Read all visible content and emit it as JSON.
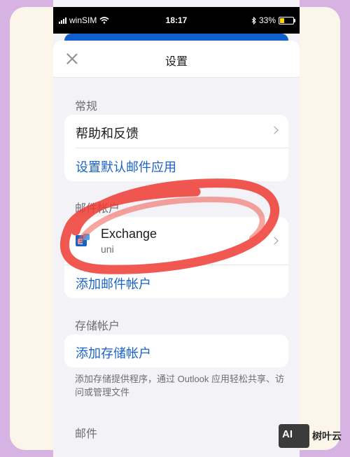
{
  "status_bar": {
    "carrier": "winSIM",
    "time": "18:17",
    "battery_percent": "33%",
    "battery_level": 0.33,
    "icons": [
      "signal-icon",
      "wifi-icon",
      "bluetooth-icon",
      "battery-icon"
    ]
  },
  "nav": {
    "title": "设置",
    "close_icon": "close-icon"
  },
  "sections": {
    "general": {
      "header": "常规",
      "help_label": "帮助和反馈",
      "default_mail_label": "设置默认邮件应用"
    },
    "mail_accounts": {
      "header": "邮件帐户",
      "account_name": "Exchange",
      "account_sub": "uni",
      "add_label": "添加邮件帐户"
    },
    "storage_accounts": {
      "header": "存储帐户",
      "add_label": "添加存储帐户",
      "footnote": "添加存储提供程序，通过 Outlook 应用轻松共享、访问或管理文件"
    },
    "mail": {
      "header": "邮件"
    }
  },
  "watermark": {
    "logo_text": "AI",
    "text": "树叶云"
  },
  "colors": {
    "accent": "#1a62c9",
    "exchange_blue": "#1565c0",
    "annotation_red": "#ef3b33",
    "frame_background": "#d7b3e3"
  }
}
